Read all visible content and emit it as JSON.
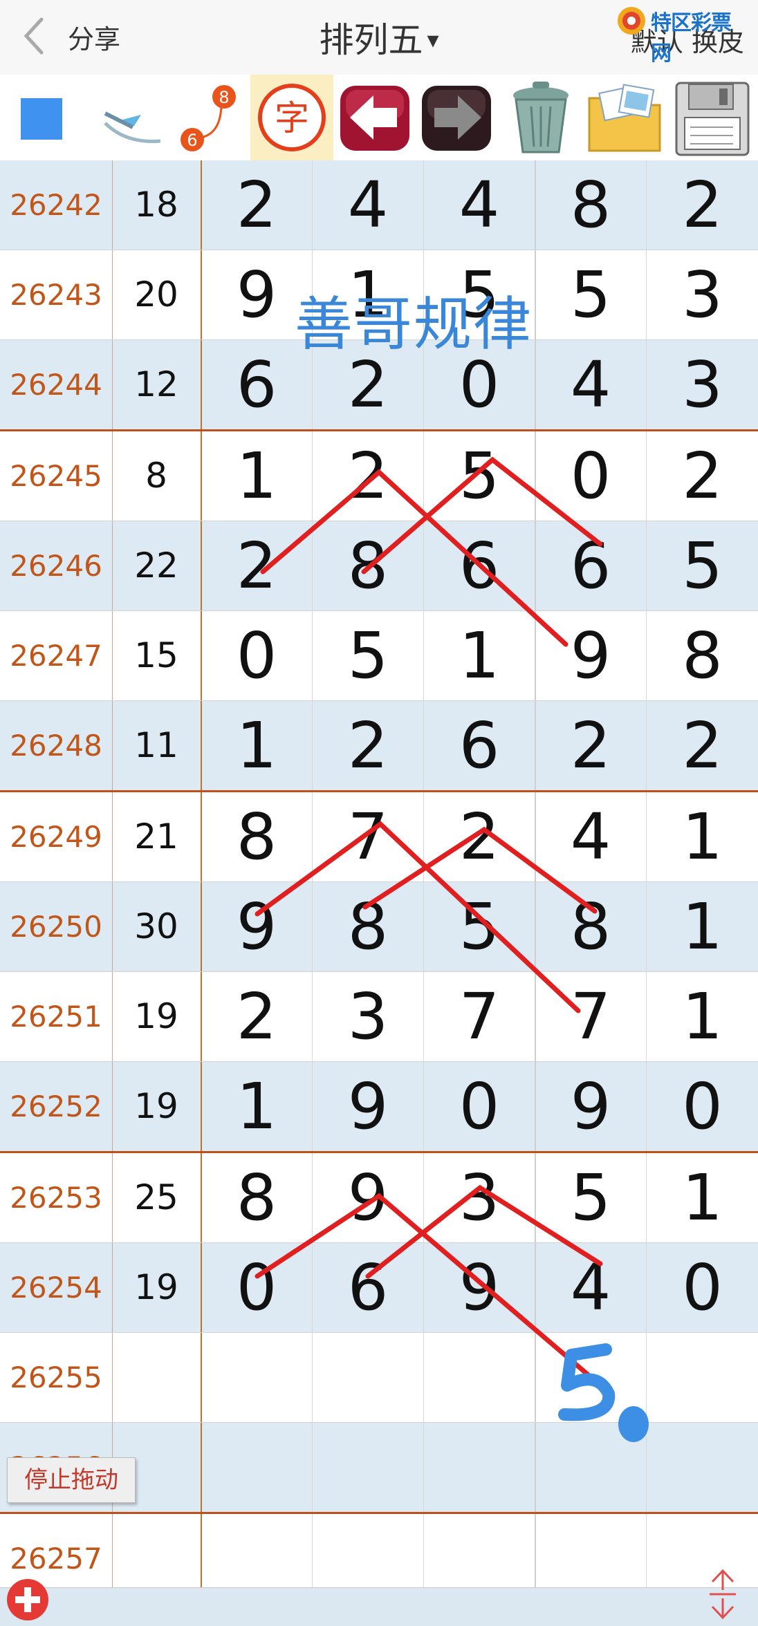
{
  "header": {
    "share_label": "分享",
    "title": "排列五",
    "title_caret": "▾",
    "skin_label": "默认 换皮",
    "logo_text": "特区彩票网"
  },
  "toolbar": {
    "tools": [
      {
        "name": "color-square-icon"
      },
      {
        "name": "pen-icon"
      },
      {
        "name": "connect-numbers-icon",
        "label_a": "8",
        "label_b": "6"
      },
      {
        "name": "text-icon",
        "label": "字"
      },
      {
        "name": "undo-arrow-icon"
      },
      {
        "name": "redo-arrow-icon"
      },
      {
        "name": "trash-icon"
      },
      {
        "name": "photos-icon"
      },
      {
        "name": "save-disk-icon"
      }
    ]
  },
  "rows": [
    {
      "issue": "26242",
      "sum": "18",
      "digits": [
        "2",
        "4",
        "4",
        "8",
        "2"
      ]
    },
    {
      "issue": "26243",
      "sum": "20",
      "digits": [
        "9",
        "1",
        "5",
        "5",
        "3"
      ]
    },
    {
      "issue": "26244",
      "sum": "12",
      "digits": [
        "6",
        "2",
        "0",
        "4",
        "3"
      ]
    },
    {
      "issue": "26245",
      "sum": "8",
      "digits": [
        "1",
        "2",
        "5",
        "0",
        "2"
      ]
    },
    {
      "issue": "26246",
      "sum": "22",
      "digits": [
        "2",
        "8",
        "6",
        "6",
        "5"
      ]
    },
    {
      "issue": "26247",
      "sum": "15",
      "digits": [
        "0",
        "5",
        "1",
        "9",
        "8"
      ]
    },
    {
      "issue": "26248",
      "sum": "11",
      "digits": [
        "1",
        "2",
        "6",
        "2",
        "2"
      ]
    },
    {
      "issue": "26249",
      "sum": "21",
      "digits": [
        "8",
        "7",
        "2",
        "4",
        "1"
      ]
    },
    {
      "issue": "26250",
      "sum": "30",
      "digits": [
        "9",
        "8",
        "5",
        "8",
        "1"
      ]
    },
    {
      "issue": "26251",
      "sum": "19",
      "digits": [
        "2",
        "3",
        "7",
        "7",
        "1"
      ]
    },
    {
      "issue": "26252",
      "sum": "19",
      "digits": [
        "1",
        "9",
        "0",
        "9",
        "0"
      ]
    },
    {
      "issue": "26253",
      "sum": "25",
      "digits": [
        "8",
        "9",
        "3",
        "5",
        "1"
      ]
    },
    {
      "issue": "26254",
      "sum": "19",
      "digits": [
        "0",
        "6",
        "9",
        "4",
        "0"
      ]
    },
    {
      "issue": "26255",
      "sum": "",
      "digits": [
        "",
        "",
        "",
        "",
        ""
      ]
    },
    {
      "issue": "26256",
      "sum": "",
      "digits": [
        "",
        "",
        "",
        "",
        ""
      ]
    },
    {
      "issue": "26257",
      "sum": "",
      "digits": [
        "",
        "",
        "",
        "",
        ""
      ]
    }
  ],
  "annotations": {
    "watermark": "善哥规律",
    "handwritten_prediction": "5",
    "line_color": "#e02020",
    "prediction_color": "#3d8fe6"
  },
  "controls": {
    "stop_drag_label": "停止拖动"
  },
  "colors": {
    "issue_text": "#c0561a",
    "separator": "#c0501a",
    "alt_row": "#ddeaf3"
  }
}
